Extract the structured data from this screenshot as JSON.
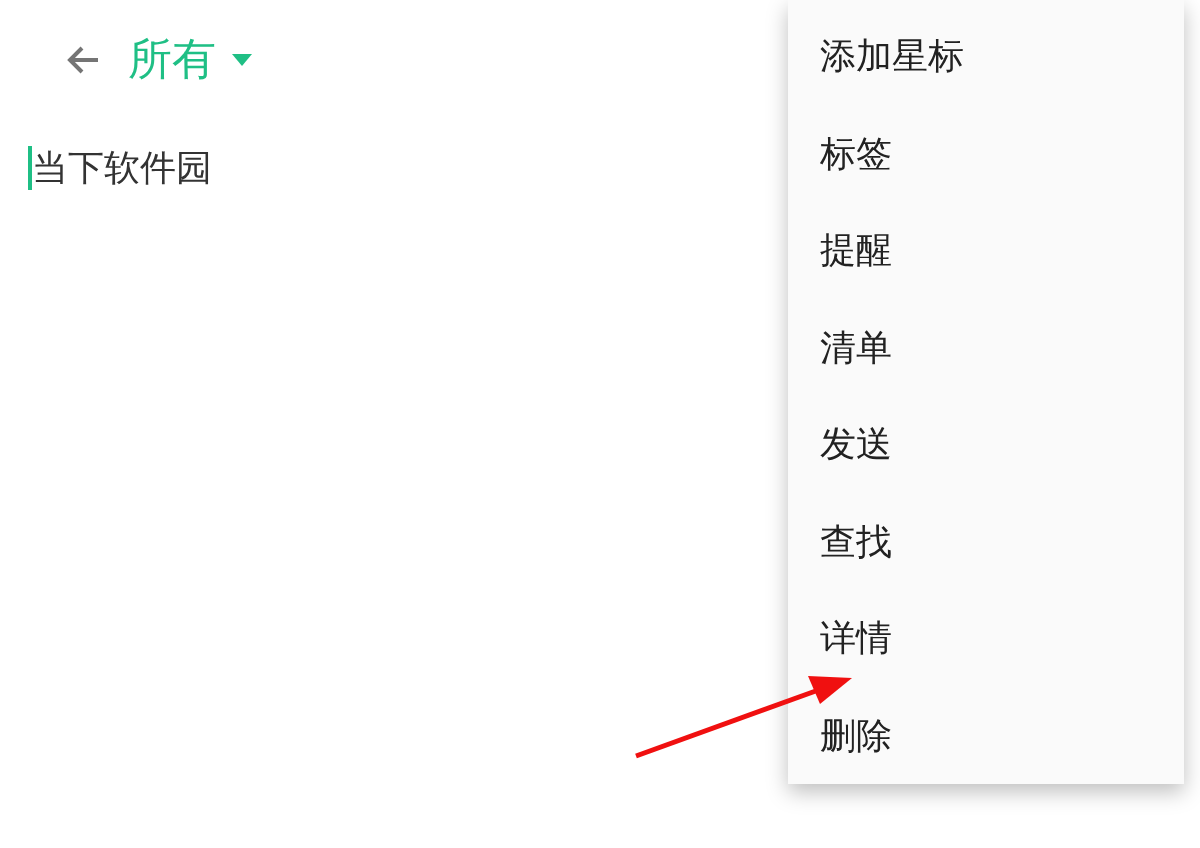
{
  "toolbar": {
    "title": "所有"
  },
  "note": {
    "text": "当下软件园"
  },
  "menu": {
    "items": [
      {
        "label": "添加星标"
      },
      {
        "label": "标签"
      },
      {
        "label": "提醒"
      },
      {
        "label": "清单"
      },
      {
        "label": "发送"
      },
      {
        "label": "查找"
      },
      {
        "label": "详情"
      },
      {
        "label": "删除"
      }
    ]
  }
}
